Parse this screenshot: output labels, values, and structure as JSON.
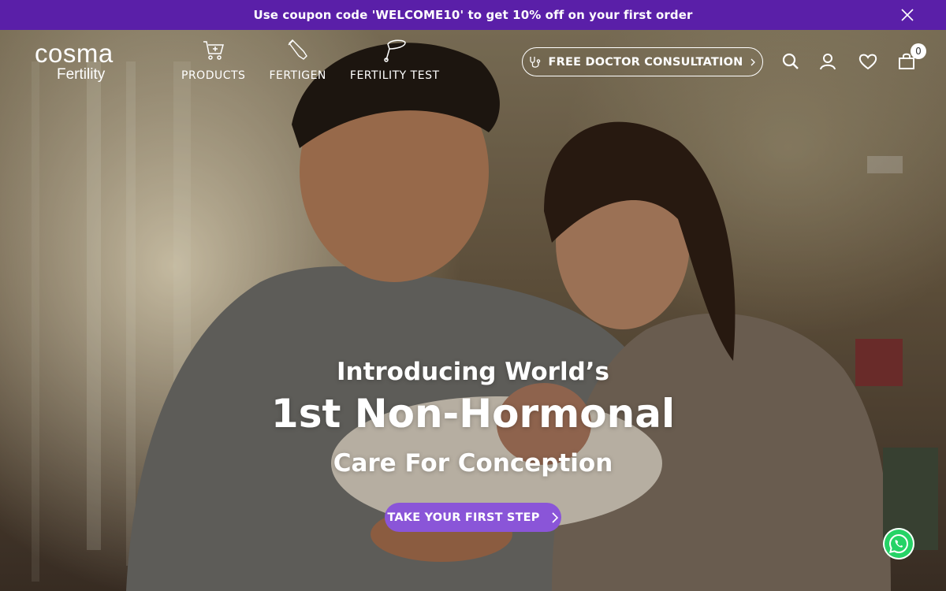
{
  "announcement": {
    "text": "Use coupon code 'WELCOME10' to get 10% off on your first order",
    "close_icon": "close-icon"
  },
  "brand": {
    "logo_word": "cosma",
    "logo_sub": "Fertility"
  },
  "nav": {
    "items": [
      {
        "label": "PRODUCTS",
        "icon": "cart-plus-icon"
      },
      {
        "label": "FERTIGEN",
        "icon": "tube-icon"
      },
      {
        "label": "FERTILITY TEST",
        "icon": "test-kit-icon"
      }
    ]
  },
  "header": {
    "consult_label": "FREE DOCTOR CONSULTATION",
    "consult_icon": "stethoscope-icon",
    "search_icon": "search-icon",
    "account_icon": "user-icon",
    "wishlist_icon": "heart-icon",
    "cart_icon": "shopping-bag-icon",
    "cart_count": "0"
  },
  "hero": {
    "line1": "Introducing World’s",
    "line2": "1st Non-Hormonal",
    "line3": "Care For Conception",
    "cta_label": "TAKE YOUR FIRST STEP",
    "image_alt": "parents holding a newborn baby"
  },
  "chat": {
    "icon": "whatsapp-icon"
  },
  "colors": {
    "announcement_bg": "#5a1fa8",
    "cta_bg": "#8a55d8",
    "whatsapp": "#25d366"
  }
}
